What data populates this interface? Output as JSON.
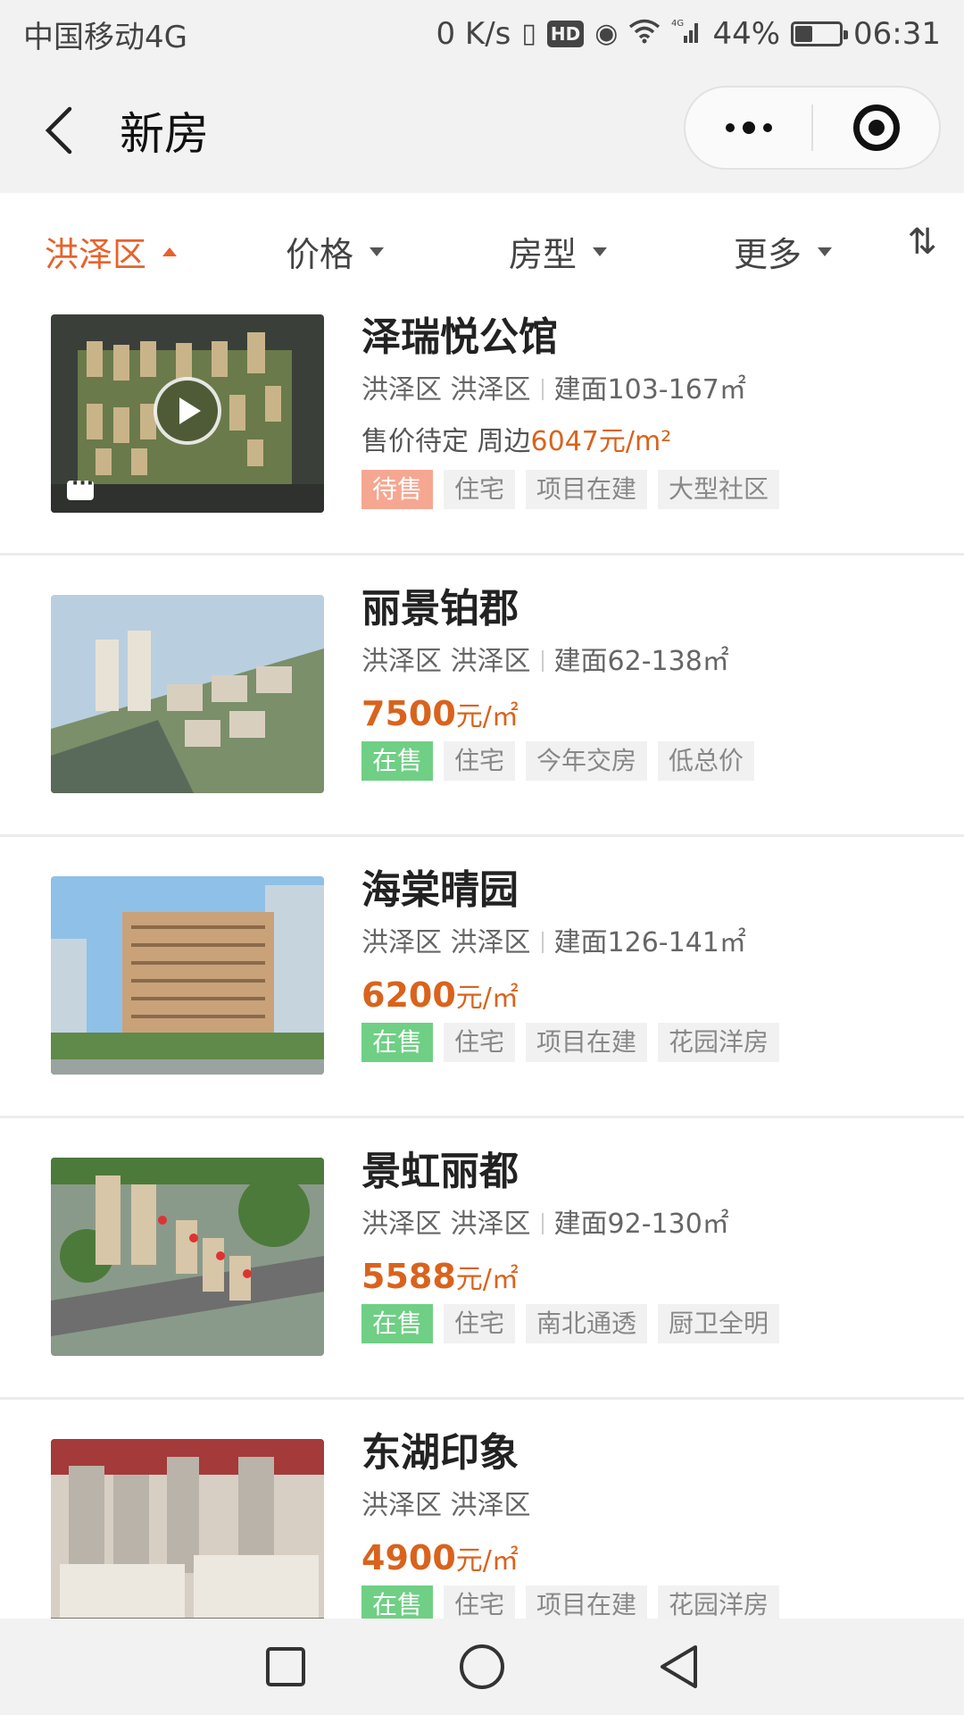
{
  "status_bar": {
    "carrier": "中国移动4G",
    "speed": "0 K/s",
    "hd": "HD",
    "network": "4G",
    "battery_percent": "44%",
    "battery_level": 0.44,
    "time": "06:31"
  },
  "header": {
    "title": "新房"
  },
  "filters": [
    {
      "label": "洪泽区",
      "active": true
    },
    {
      "label": "价格",
      "active": false
    },
    {
      "label": "房型",
      "active": false
    },
    {
      "label": "更多",
      "active": false
    }
  ],
  "sort_icon": "⇅",
  "listings": [
    {
      "name": "泽瑞悦公馆",
      "district": "洪泽区 洪泽区",
      "area": "建面103-167㎡",
      "price_pending": "售价待定 周边",
      "price_nearby": "6047元/m²",
      "status": "待售",
      "tags": [
        "住宅",
        "项目在建",
        "大型社区"
      ]
    },
    {
      "name": "丽景铂郡",
      "district": "洪泽区 洪泽区",
      "area": "建面62-138㎡",
      "price_value": "7500",
      "price_unit": "元/㎡",
      "status": "在售",
      "tags": [
        "住宅",
        "今年交房",
        "低总价"
      ]
    },
    {
      "name": "海棠晴园",
      "district": "洪泽区 洪泽区",
      "area": "建面126-141㎡",
      "price_value": "6200",
      "price_unit": "元/㎡",
      "status": "在售",
      "tags": [
        "住宅",
        "项目在建",
        "花园洋房"
      ]
    },
    {
      "name": "景虹丽都",
      "district": "洪泽区 洪泽区",
      "area": "建面92-130㎡",
      "price_value": "5588",
      "price_unit": "元/㎡",
      "status": "在售",
      "tags": [
        "住宅",
        "南北通透",
        "厨卫全明"
      ]
    },
    {
      "name": "东湖印象",
      "district": "洪泽区 洪泽区",
      "price_value": "4900",
      "price_unit": "元/㎡",
      "status": "在售",
      "tags": [
        "住宅",
        "项目在建",
        "花园洋房"
      ]
    }
  ],
  "colors": {
    "accent": "#e8622b",
    "price": "#d9631d",
    "status_sale": "#6fcf84",
    "status_pending": "#f6a792"
  }
}
